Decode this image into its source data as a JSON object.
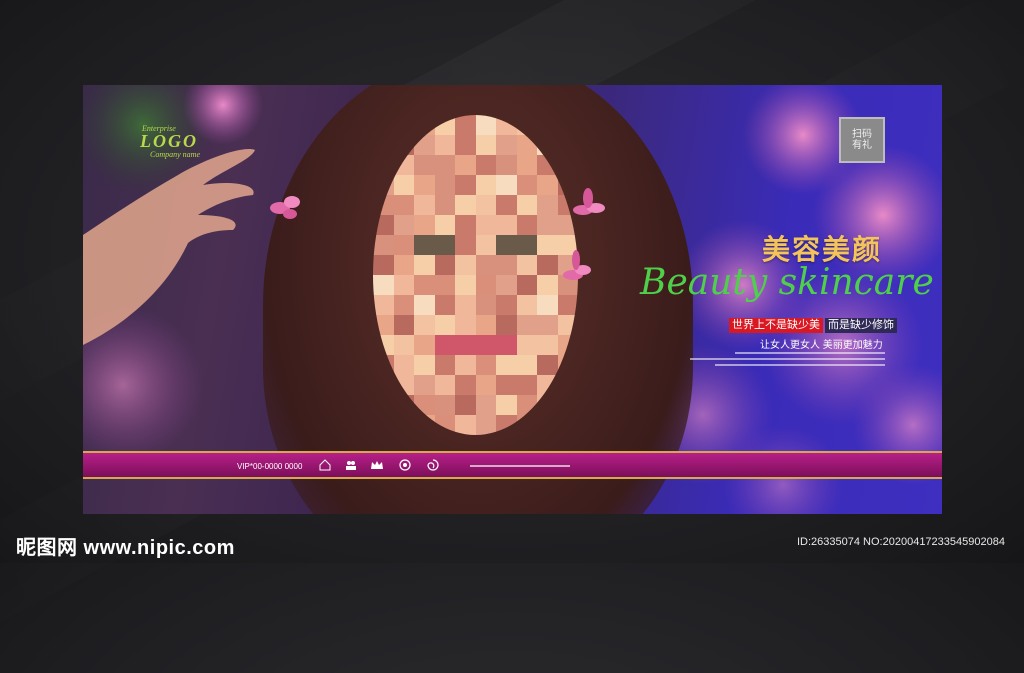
{
  "logo": {
    "enterprise": "Enterprise",
    "mark": "LOGO",
    "company": "Company name"
  },
  "qr": {
    "label": "扫码有礼"
  },
  "headline": {
    "cn": "美容美颜",
    "en": "Beauty skincare"
  },
  "slogan": {
    "part1": "世界上不是缺少美",
    "part2": "而是缺少修饰",
    "line2": "让女人更女人 美丽更加魅力"
  },
  "footer_bar": {
    "vip": "VIP*00-0000 0000"
  },
  "watermark": {
    "site": "昵图网 www.nipic.com",
    "id": "ID:26335074 NO:20200417233545902084"
  },
  "colors": {
    "accent_gold": "#f3c45a",
    "accent_green": "#4fd04a",
    "bar_magenta": "#97166f",
    "badge_red": "#d81822"
  }
}
